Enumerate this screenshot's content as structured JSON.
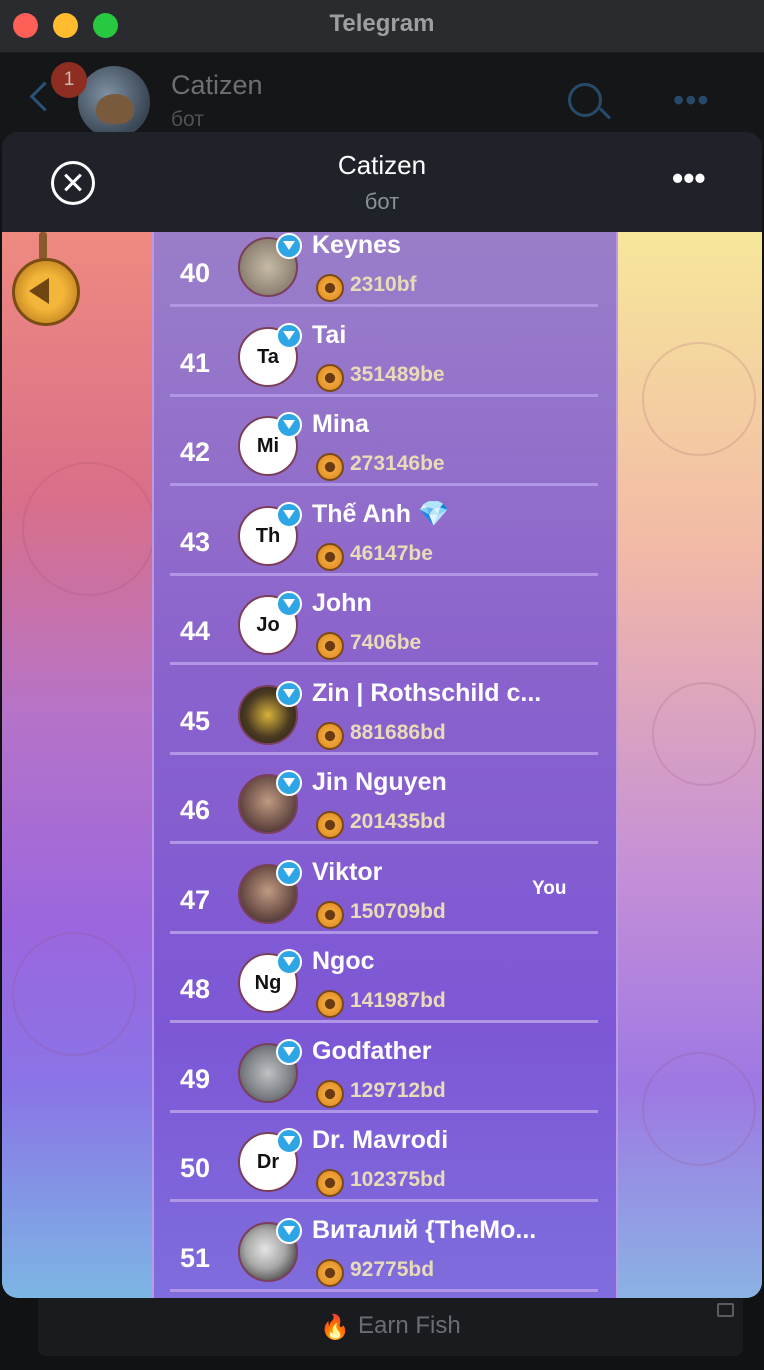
{
  "window": {
    "title": "Telegram"
  },
  "chat": {
    "unread_count": "1",
    "name": "Catizen",
    "subtitle": "бот"
  },
  "sheet": {
    "title": "Catizen",
    "subtitle": "бот"
  },
  "leaderboard": {
    "rows": [
      {
        "rank": "40",
        "initials": "",
        "name": "Keynes",
        "score": "2310bf",
        "you": ""
      },
      {
        "rank": "41",
        "initials": "Ta",
        "name": "Tai",
        "score": "351489be",
        "you": ""
      },
      {
        "rank": "42",
        "initials": "Mi",
        "name": "Mina",
        "score": "273146be",
        "you": ""
      },
      {
        "rank": "43",
        "initials": "Th",
        "name": "Thế Anh 💎",
        "score": "46147be",
        "you": ""
      },
      {
        "rank": "44",
        "initials": "Jo",
        "name": "John",
        "score": "7406be",
        "you": ""
      },
      {
        "rank": "45",
        "initials": "",
        "name": "Zin | Rothschild c...",
        "score": "881686bd",
        "you": ""
      },
      {
        "rank": "46",
        "initials": "",
        "name": "Jin Nguyen",
        "score": "201435bd",
        "you": ""
      },
      {
        "rank": "47",
        "initials": "",
        "name": "Viktor",
        "score": "150709bd",
        "you": "You"
      },
      {
        "rank": "48",
        "initials": "Ng",
        "name": "Ngoc",
        "score": "141987bd",
        "you": ""
      },
      {
        "rank": "49",
        "initials": "",
        "name": "Godfather",
        "score": "129712bd",
        "you": ""
      },
      {
        "rank": "50",
        "initials": "Dr",
        "name": "Dr. Mavrodi",
        "score": "102375bd",
        "you": ""
      },
      {
        "rank": "51",
        "initials": "",
        "name": "Виталий {TheMo...",
        "score": "92775bd",
        "you": ""
      }
    ]
  },
  "bottom": {
    "button_label": "Earn Fish",
    "icon": "fire-icon"
  }
}
